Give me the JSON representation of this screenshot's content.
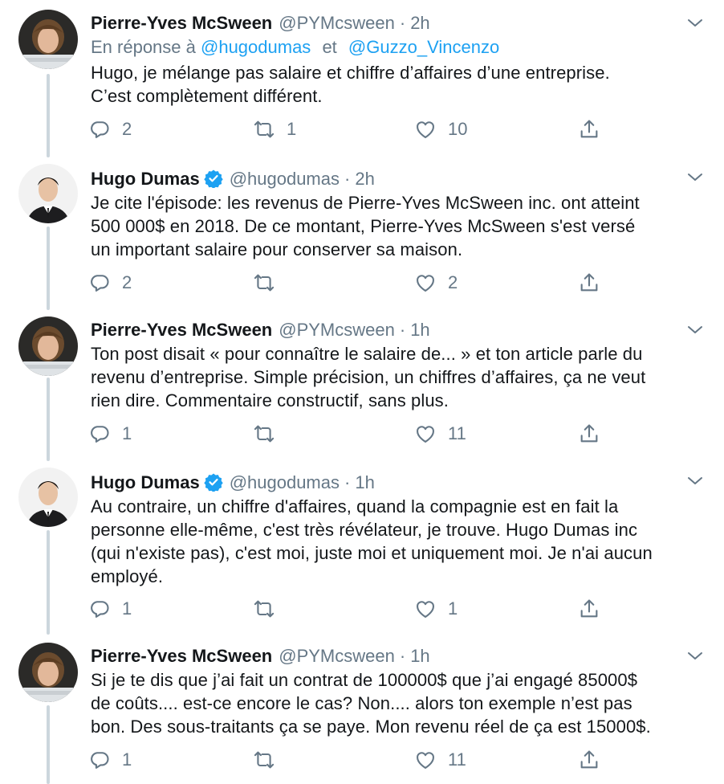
{
  "tweets": [
    {
      "author": "Pierre-Yves McSween",
      "handle": "@PYMcsween",
      "separator": "·",
      "time": "2h",
      "verified": false,
      "avatar": "pierre-yves-avatar",
      "reply_prefix": "En réponse à",
      "reply_user1": "@hugodumas",
      "reply_join": "et",
      "reply_user2": "@Guzzo_Vincenzo",
      "lines": [
        "Hugo, je mélange pas salaire et chiffre d’affaires d’une entreprise.",
        "C’est complètement différent."
      ],
      "replies": "2",
      "retweets": "1",
      "likes": "10"
    },
    {
      "author": "Hugo Dumas",
      "handle": "@hugodumas",
      "separator": "·",
      "time": "2h",
      "verified": true,
      "avatar": "hugo-avatar",
      "lines": [
        "Je cite l'épisode: les revenus de Pierre-Yves McSween inc. ont atteint",
        "500 000$ en 2018. De ce montant, Pierre-Yves McSween s'est versé",
        "un important salaire pour conserver sa maison."
      ],
      "replies": "2",
      "retweets": "",
      "likes": "2"
    },
    {
      "author": "Pierre-Yves McSween",
      "handle": "@PYMcsween",
      "separator": "·",
      "time": "1h",
      "verified": false,
      "avatar": "pierre-yves-avatar",
      "lines": [
        "Ton post disait « pour connaître le salaire de... » et ton article parle du",
        "revenu d’entreprise. Simple précision, un chiffres d’affaires, ça ne veut",
        "rien dire.  Commentaire constructif, sans plus."
      ],
      "replies": "1",
      "retweets": "",
      "likes": "11"
    },
    {
      "author": "Hugo Dumas",
      "handle": "@hugodumas",
      "separator": "·",
      "time": "1h",
      "verified": true,
      "avatar": "hugo-avatar",
      "lines": [
        "Au contraire, un chiffre d'affaires, quand la compagnie est en fait la",
        "personne elle-même, c'est très révélateur, je trouve. Hugo Dumas inc",
        "(qui n'existe pas), c'est moi, juste moi et uniquement moi. Je n'ai aucun",
        "employé."
      ],
      "replies": "1",
      "retweets": "",
      "likes": "1"
    },
    {
      "author": "Pierre-Yves McSween",
      "handle": "@PYMcsween",
      "separator": "·",
      "time": "1h",
      "verified": false,
      "avatar": "pierre-yves-avatar",
      "lines": [
        "Si je te dis que j’ai fait un contrat de 100000$ que j’ai engagé 85000$",
        "de coûts.... est-ce encore le cas? Non.... alors ton exemple n’est pas",
        "bon. Des sous-traitants ça se paye. Mon revenu réel de ça est 15000$."
      ],
      "replies": "1",
      "retweets": "",
      "likes": "11"
    }
  ],
  "colors": {
    "text": "#14171a",
    "secondary": "#657786",
    "link": "#1da1f2",
    "thread_line": "#ccd6dd"
  },
  "icons": [
    "reply-icon",
    "retweet-icon",
    "like-icon",
    "share-icon",
    "caret-down-icon",
    "verified-badge-icon"
  ]
}
